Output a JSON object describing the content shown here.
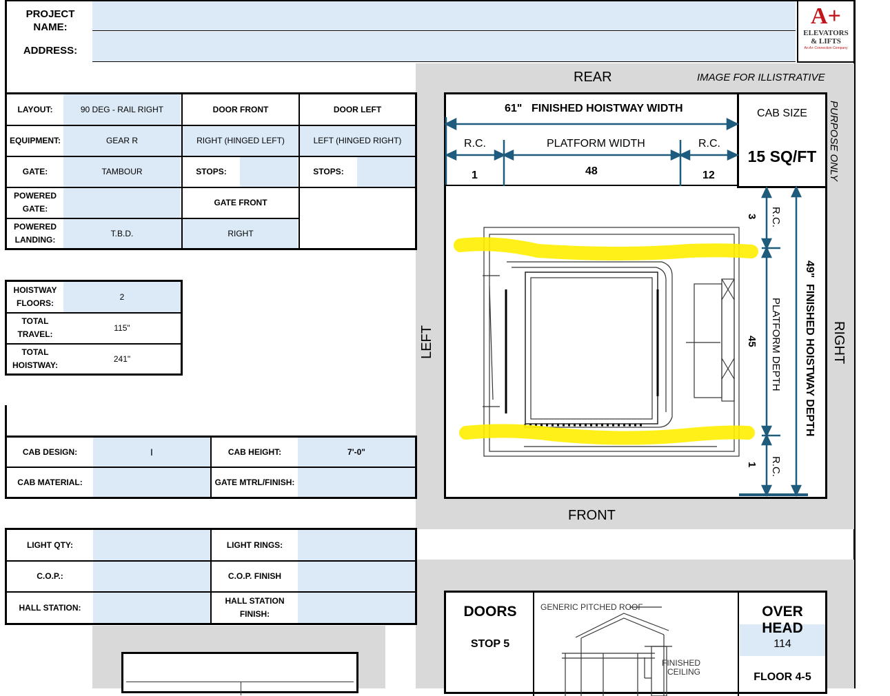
{
  "header": {
    "project_name_label": "PROJECT NAME:",
    "address_label": "ADDRESS:",
    "project_name_value": "",
    "address_value": ""
  },
  "logo": {
    "mark": "A+",
    "line1": "ELEVATORS",
    "line2": "& LIFTS",
    "tagline": "An A+ Connection Company",
    "accent_color": "#c0161b"
  },
  "layout_table": {
    "layout_label": "LAYOUT:",
    "layout_value": "90 DEG - RAIL RIGHT",
    "door_front": "DOOR FRONT",
    "door_left": "DOOR LEFT",
    "equipment_label": "EQUIPMENT:",
    "equipment_value": "GEAR R",
    "door_front_value": "RIGHT (HINGED LEFT)",
    "door_left_value": "LEFT (HINGED RIGHT)",
    "gate_label": "GATE:",
    "gate_value": "TAMBOUR",
    "stops_label_1": "STOPS:",
    "stops_value_1": "",
    "stops_label_2": "STOPS:",
    "stops_value_2": "",
    "powered_gate_label_1": "POWERED",
    "powered_gate_label_2": "GATE:",
    "powered_gate_value": "",
    "gate_front_label": "GATE FRONT",
    "powered_landing_label_1": "POWERED",
    "powered_landing_label_2": "LANDING:",
    "powered_landing_value": "T.B.D.",
    "gate_front_value": "RIGHT"
  },
  "hoistway_table": {
    "floors_label_1": "HOISTWAY",
    "floors_label_2": "FLOORS:",
    "floors_value": "2",
    "travel_label_1": "TOTAL",
    "travel_label_2": "TRAVEL:",
    "travel_value": "115\"",
    "hoistway_label_1": "TOTAL",
    "hoistway_label_2": "HOISTWAY:",
    "hoistway_value": "241\""
  },
  "cab_table": {
    "design_label": "CAB DESIGN:",
    "design_value": "I",
    "height_label": "CAB HEIGHT:",
    "height_value": "7'-0\"",
    "material_label": "CAB MATERIAL:",
    "material_value": "",
    "gate_mtrl_label": "GATE MTRL/FINISH:",
    "gate_mtrl_value": ""
  },
  "light_table": {
    "light_qty_label": "LIGHT QTY:",
    "light_qty_value": "",
    "light_rings_label": "LIGHT RINGS:",
    "light_rings_value": "",
    "cop_label": "C.O.P.:",
    "cop_value": "",
    "cop_finish_label": "C.O.P. FINISH",
    "cop_finish_value": "",
    "hall_station_label": "HALL STATION:",
    "hall_station_value": "",
    "hall_finish_label_1": "HALL STATION",
    "hall_finish_label_2": "FINISH:",
    "hall_finish_value": ""
  },
  "plan": {
    "rear": "REAR",
    "front": "FRONT",
    "left": "LEFT",
    "right": "RIGHT",
    "illustrative_1": "IMAGE FOR ILLISTRATIVE",
    "illustrative_2": "PURPOSE ONLY",
    "width_value": "61\"",
    "width_label": "FINISHED HOISTWAY WIDTH",
    "rc_left_label": "R.C.",
    "platform_width_label": "PLATFORM WIDTH",
    "rc_right_label": "R.C.",
    "rc_left_value": "1",
    "platform_width_value": "48",
    "rc_right_value": "12",
    "cab_size_label": "CAB SIZE",
    "cab_size_value": "15 SQ/FT",
    "rc_top_value": "3",
    "rc_top_label": "R.C.",
    "platform_depth_value": "45",
    "platform_depth_label": "PLATFORM DEPTH",
    "rc_bottom_value": "1",
    "rc_bottom_label": "R.C.",
    "depth_value": "49\"",
    "depth_label": "FINISHED HOISTWAY DEPTH",
    "highlight_color": "#ffee00",
    "dim_color": "#1f5b7c"
  },
  "bottom": {
    "doors_label": "DOORS",
    "doors_value": "STOP 5",
    "roof_label": "GENERIC PITCHED ROOF",
    "ceiling_label_1": "FINISHED",
    "ceiling_label_2": "CEILING",
    "overhead_label": "OVER HEAD",
    "overhead_value": "114",
    "floor_value": "FLOOR 4-5"
  }
}
